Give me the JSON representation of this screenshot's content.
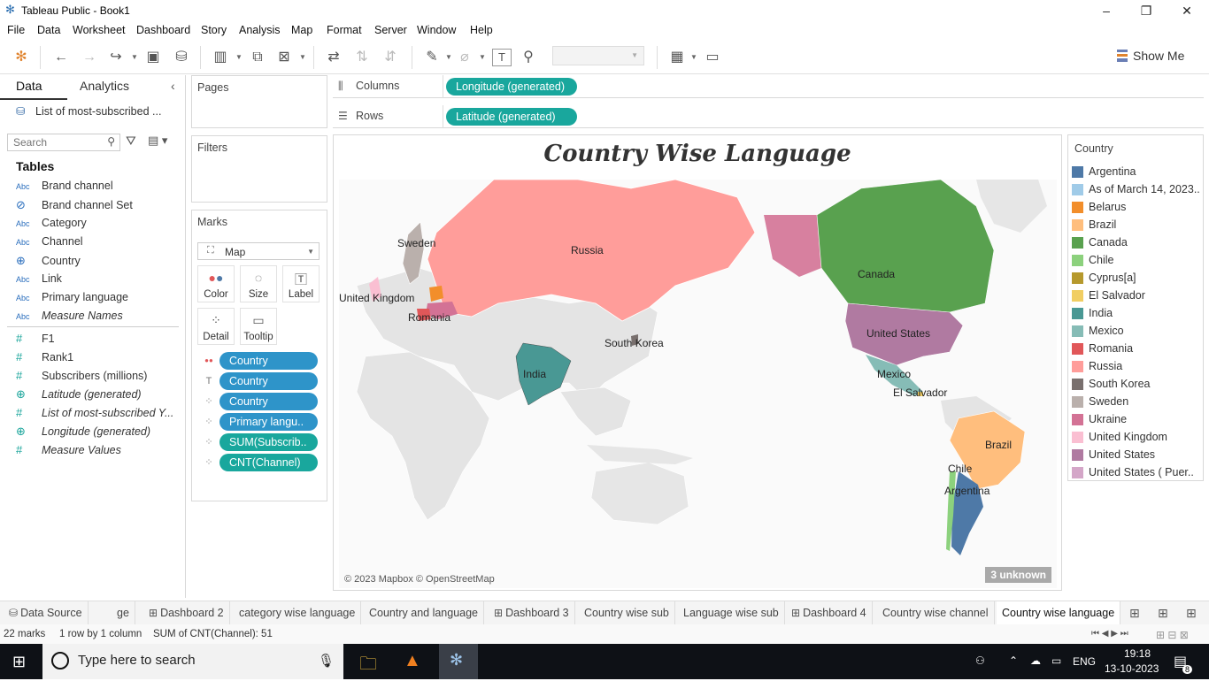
{
  "window": {
    "title": "Tableau Public - Book1"
  },
  "menu": [
    "File",
    "Data",
    "Worksheet",
    "Dashboard",
    "Story",
    "Analysis",
    "Map",
    "Format",
    "Server",
    "Window",
    "Help"
  ],
  "toolbar": {
    "show_me": "Show Me",
    "fit_value": ""
  },
  "data_pane": {
    "tab_data": "Data",
    "tab_analytics": "Analytics",
    "datasource": "List of most-subscribed ...",
    "search_placeholder": "Search",
    "tables_header": "Tables",
    "fields": [
      {
        "type": "Abc",
        "name": "Brand channel",
        "italic": false
      },
      {
        "type": "set",
        "name": "Brand channel Set",
        "italic": false
      },
      {
        "type": "Abc",
        "name": "Category",
        "italic": false
      },
      {
        "type": "Abc",
        "name": "Channel",
        "italic": false
      },
      {
        "type": "geo",
        "name": "Country",
        "italic": false
      },
      {
        "type": "Abc",
        "name": "Link",
        "italic": false
      },
      {
        "type": "Abc",
        "name": "Primary language",
        "italic": false
      },
      {
        "type": "Abc",
        "name": "Measure Names",
        "italic": true
      },
      {
        "type": "#",
        "name": "F1",
        "italic": false
      },
      {
        "type": "#",
        "name": "Rank1",
        "italic": false
      },
      {
        "type": "#",
        "name": "Subscribers (millions)",
        "italic": false
      },
      {
        "type": "geom",
        "name": "Latitude (generated)",
        "italic": true
      },
      {
        "type": "#",
        "name": "List of most-subscribed Y...",
        "italic": true
      },
      {
        "type": "geom",
        "name": "Longitude (generated)",
        "italic": true
      },
      {
        "type": "#",
        "name": "Measure Values",
        "italic": true
      }
    ]
  },
  "pages": {
    "title": "Pages"
  },
  "filters": {
    "title": "Filters"
  },
  "marks": {
    "title": "Marks",
    "mark_type": "Map",
    "buttons": [
      "Color",
      "Size",
      "Label",
      "Detail",
      "Tooltip"
    ],
    "pills": [
      {
        "icon": "color",
        "label": "Country",
        "kind": "dim"
      },
      {
        "icon": "label",
        "label": "Country",
        "kind": "dim"
      },
      {
        "icon": "detail",
        "label": "Country",
        "kind": "dim"
      },
      {
        "icon": "detail",
        "label": "Primary langu..",
        "kind": "dim"
      },
      {
        "icon": "detail",
        "label": "SUM(Subscrib..",
        "kind": "meas"
      },
      {
        "icon": "detail",
        "label": "CNT(Channel)",
        "kind": "meas"
      }
    ]
  },
  "shelves": {
    "columns_label": "Columns",
    "columns_pill": "Longitude (generated)",
    "rows_label": "Rows",
    "rows_pill": "Latitude (generated)"
  },
  "view": {
    "title": "Country Wise Language",
    "credits": "© 2023 Mapbox © OpenStreetMap",
    "unknown": "3 unknown",
    "map_labels": [
      "Russia",
      "Sweden",
      "United Kingdom",
      "Romania",
      "South Korea",
      "India",
      "Canada",
      "United States",
      "Mexico",
      "El Salvador",
      "Brazil",
      "Chile",
      "Argentina"
    ]
  },
  "legend": {
    "title": "Country",
    "items": [
      {
        "label": "Argentina",
        "color": "#4e79a7"
      },
      {
        "label": "As of March 14, 2023..",
        "color": "#a0cbe8"
      },
      {
        "label": "Belarus",
        "color": "#f28e2b"
      },
      {
        "label": "Brazil",
        "color": "#ffbe7d"
      },
      {
        "label": "Canada",
        "color": "#59a14f"
      },
      {
        "label": "Chile",
        "color": "#8cd17d"
      },
      {
        "label": "Cyprus[a]",
        "color": "#b6992d"
      },
      {
        "label": "El Salvador",
        "color": "#f1ce63"
      },
      {
        "label": "India",
        "color": "#499894"
      },
      {
        "label": "Mexico",
        "color": "#86bcb6"
      },
      {
        "label": "Romania",
        "color": "#e15759"
      },
      {
        "label": "Russia",
        "color": "#ff9d9a"
      },
      {
        "label": "South Korea",
        "color": "#79706e"
      },
      {
        "label": "Sweden",
        "color": "#bab0ac"
      },
      {
        "label": "Ukraine",
        "color": "#d37295"
      },
      {
        "label": "United Kingdom",
        "color": "#fabfd2"
      },
      {
        "label": "United States",
        "color": "#b07aa1"
      },
      {
        "label": "United States ( Puer..",
        "color": "#d4a6c8"
      }
    ]
  },
  "sheet_tabs": [
    {
      "label": "Data Source",
      "icon": "ds"
    },
    {
      "label": "ge",
      "icon": ""
    },
    {
      "label": "Dashboard 2",
      "icon": "db"
    },
    {
      "label": "category wise language",
      "icon": ""
    },
    {
      "label": "Country and language",
      "icon": ""
    },
    {
      "label": "Dashboard 3",
      "icon": "db"
    },
    {
      "label": "Country wise sub",
      "icon": ""
    },
    {
      "label": "Language wise sub",
      "icon": ""
    },
    {
      "label": "Dashboard 4",
      "icon": "db"
    },
    {
      "label": "Country wise channel",
      "icon": ""
    },
    {
      "label": "Country wise language",
      "icon": "",
      "active": true
    }
  ],
  "status": {
    "marks": "22 marks",
    "dims": "1 row by 1 column",
    "sum": "SUM of CNT(Channel): 51"
  },
  "taskbar": {
    "search_placeholder": "Type here to search",
    "lang": "ENG",
    "time": "19:18",
    "date": "13-10-2023",
    "notif_count": "8"
  }
}
